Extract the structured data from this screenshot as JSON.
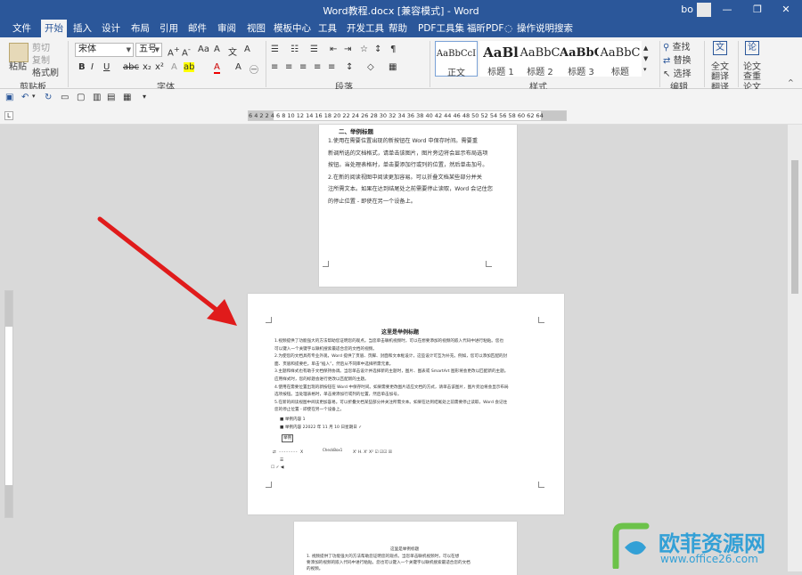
{
  "window": {
    "title": "Word教程.docx [兼容模式] - Word",
    "user": "bo",
    "minimize": "—",
    "restore": "❐",
    "close": "✕"
  },
  "tabs": [
    {
      "label": "文件"
    },
    {
      "label": "开始"
    },
    {
      "label": "插入"
    },
    {
      "label": "设计"
    },
    {
      "label": "布局"
    },
    {
      "label": "引用"
    },
    {
      "label": "邮件"
    },
    {
      "label": "审阅"
    },
    {
      "label": "视图"
    },
    {
      "label": "模板中心"
    },
    {
      "label": "工具"
    },
    {
      "label": "开发工具"
    },
    {
      "label": "帮助"
    },
    {
      "label": "PDF工具集"
    },
    {
      "label": "福昕PDF"
    },
    {
      "label": "操作说明搜索"
    }
  ],
  "active_tab": "开始",
  "ribbon": {
    "clipboard": {
      "paste": "粘贴",
      "cut": "剪切",
      "copy": "复制",
      "format_painter": "格式刷",
      "group": "剪贴板"
    },
    "font": {
      "name": "宋体",
      "size": "五号",
      "group": "字体"
    },
    "paragraph": {
      "group": "段落"
    },
    "styles": {
      "items": [
        {
          "sample": "AaBbCcI",
          "name": "正文"
        },
        {
          "sample": "AaBl",
          "name": "标题 1"
        },
        {
          "sample": "AaBbC",
          "name": "标题 2"
        },
        {
          "sample": "AaBbC",
          "name": "标题 3"
        },
        {
          "sample": "AaBbC",
          "name": "标题"
        }
      ],
      "group": "样式"
    },
    "editing": {
      "find": "查找",
      "replace": "替换",
      "select": "选择",
      "group": "编辑"
    },
    "translate": {
      "label1": "全文",
      "label2": "翻译",
      "group": "翻译"
    },
    "paper": {
      "label1": "论文",
      "label2": "查重",
      "group": "论文"
    }
  },
  "ruler": {
    "numbers": "6 4 2   2 4 6 8 10 12 14 16 18 20 22 24 26 28 30 32 34 36 38 40 42 44 46 48 50 52 54 56 58 60 62 64"
  },
  "page1": {
    "heading": "二、举例标题",
    "lines": [
      "1.使用在需要位置出现的新按钮在 Word 中保存时间。需要重",
      "新调所选的文档格式，请单击该图片，图片旁边将会显示布局选项",
      "按钮。当处理表格时，单击要添加行或列的位置，然后单击加号。",
      "2.在新的阅读视图中阅读更加容易。可以折叠文档某些部分并关",
      "注所需文本。如果在达到结尾处之前需要停止读取，Word 会记住您",
      "的停止位置 - 即使在另一个设备上。"
    ]
  },
  "page2": {
    "heading": "这里是举例标题",
    "lines": [
      "1.视频提供了功能强大的方法帮助您证明您的观点。当您单击联机视频时，可以在想要添加的视频的嵌入代码中进行粘贴。您也",
      "可以键入一个关键字以联机搜索最适合您的文档的视频。",
      "2.为使您的文档具有专业外观，Word 提供了页眉、页脚、封面和文本框设计，这些设计可互为补充。例如，您可以添加匹配的封",
      "面、页眉和提要栏。单击“插入”，然后从不同库中选择所需元素。",
      "3.主题和样式也有助于文档保持协调。当您单击设计并选择新的主题时，图片、图表或 SmartArt 图形将会更改以匹配新的主题。",
      "应用样式时，您的标题会进行更改以匹配新的主题。",
      "4.使用在需要位置出现的新按钮在 Word 中保存时间。如果需要更改图片适应文档的方式，请单击该图片，图片旁边将会显示布局",
      "选项按钮。当处理表格时，单击要添加行或列的位置，然后单击加号。",
      "5.在新的阅读视图中阅读更加容易。可以折叠文档某些部分并关注所需文本。如果在达到结尾处之前需要停止读取，Word 会记住",
      "您的停止位置 - 即使在另一个设备上。"
    ],
    "bullets": [
      "举例内容 1",
      "举例内容 22022 年 11 月 10 日星期日 ✓"
    ],
    "check_label": "举例",
    "checkbox_line": "CheckBox1"
  },
  "page3": {
    "heading": "这里是举例标题",
    "lines": [
      "1. 视频提供了功能强大的方法帮助您证明您的观点。当您单击联机视频时，可以在想",
      "要添加的视频的嵌入代码中进行粘贴。您也可以键入一个关键字以联机搜索最适合您的文档",
      "的视频。"
    ]
  },
  "watermark": {
    "name": "欧菲资源网",
    "url": "www.office26.com"
  },
  "colors": {
    "word_blue": "#2b579a",
    "ribbon_bg": "#f3f3f3",
    "canvas": "#d9d9d9",
    "arrow_red": "#e01b1b"
  }
}
